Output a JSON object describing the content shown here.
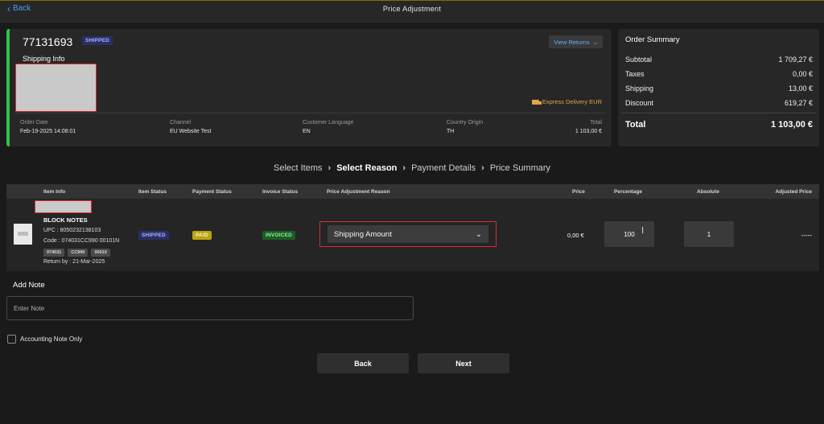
{
  "header": {
    "back_label": "Back",
    "title": "Price Adjustment"
  },
  "order": {
    "number": "77131693",
    "status_badge": "SHIPPED",
    "shipping_info_label": "Shipping Info",
    "view_returns_label": "View Returns",
    "delivery_method": "Express Delivery EUR",
    "meta": [
      {
        "label": "Order Date",
        "value": "Feb-19-2025 14:08:01"
      },
      {
        "label": "Channel",
        "value": "EU Website Test"
      },
      {
        "label": "Customer Language",
        "value": "EN"
      },
      {
        "label": "Country Origin",
        "value": "TH"
      },
      {
        "label": "Total",
        "value": "1 103,00 €"
      }
    ]
  },
  "summary": {
    "title": "Order Summary",
    "rows": [
      {
        "label": "Subtotal",
        "value": "1 709,27 €"
      },
      {
        "label": "Taxes",
        "value": "0,00 €"
      },
      {
        "label": "Shipping",
        "value": "13,00 €"
      },
      {
        "label": "Discount",
        "value": "619,27 €"
      }
    ],
    "total_label": "Total",
    "total_value": "1 103,00 €"
  },
  "steps": [
    "Select Items",
    "Select Reason",
    "Payment Details",
    "Price Summary"
  ],
  "active_step": "Select Reason",
  "table": {
    "headers": [
      "Item Info",
      "Item Status",
      "Payment Status",
      "Invoice Status",
      "Price Adjustment Reason",
      "Price",
      "Percentage",
      "Absolute",
      "Adjusted Price"
    ],
    "item": {
      "name": "BLOCK NOTES",
      "upc": "UPC : 8050232138103",
      "code": "Code : 074031CC990 00101N",
      "chips": [
        "074031",
        "CC990",
        "00010"
      ],
      "return_by": "Return by : 21-Mar-2025",
      "item_status": "SHIPPED",
      "payment_status": "PAID",
      "invoice_status": "INVOICED",
      "reason": "Shipping Amount",
      "price": "0,00 €",
      "percentage": "100",
      "absolute": "1",
      "adjusted_price": "-----"
    }
  },
  "note": {
    "label": "Add Note",
    "placeholder": "Enter Note",
    "value": ""
  },
  "accounting_note_label": "Accounting Note Only",
  "buttons": {
    "back": "Back",
    "next": "Next"
  },
  "colors": {
    "accent_green": "#2ec24a",
    "link_blue": "#4a9cf0",
    "express_orange": "#e2a548",
    "highlight_red": "#d9302a"
  }
}
